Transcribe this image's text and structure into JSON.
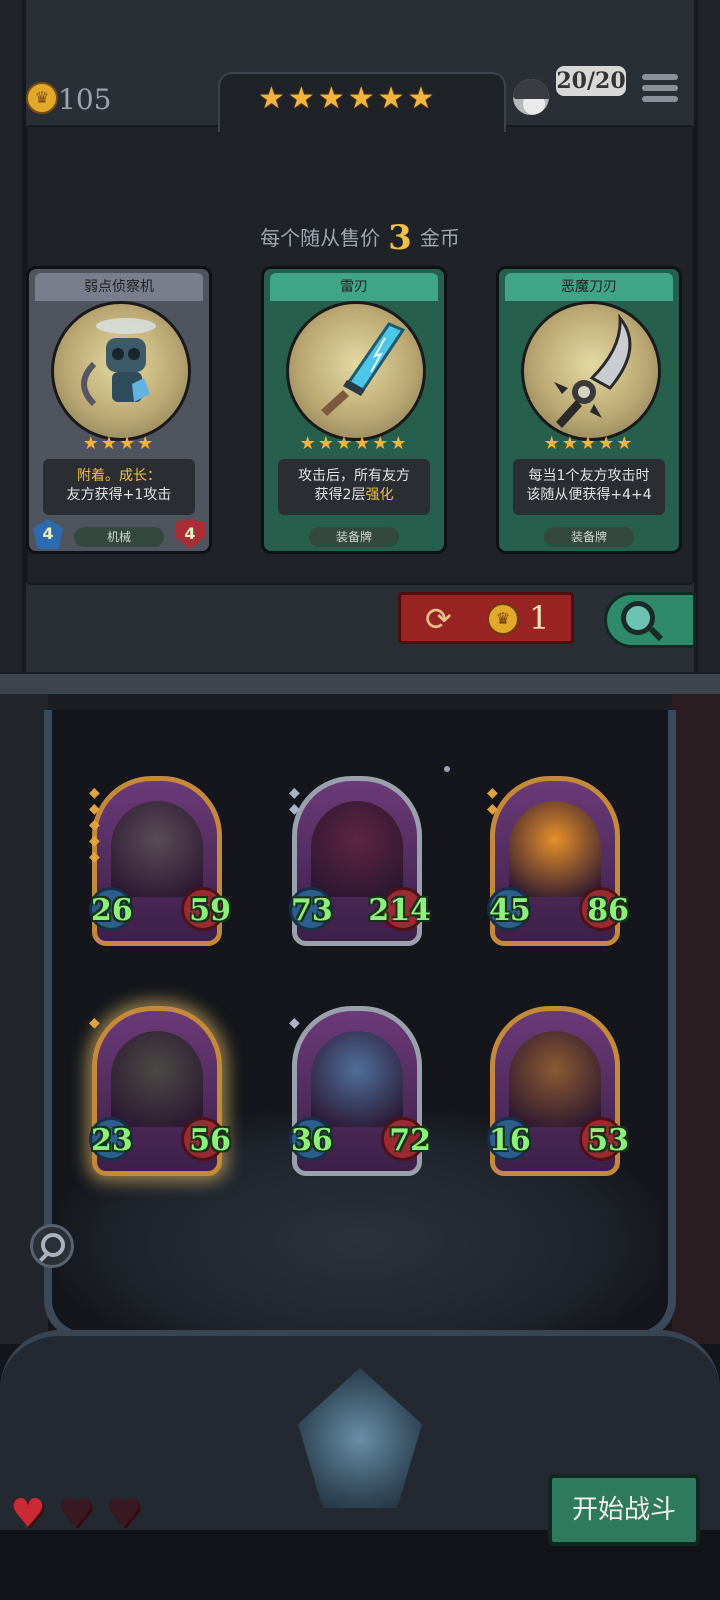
{
  "hud": {
    "gold": "105",
    "tavern_stars": 6,
    "health": "20/20",
    "sell_text": "每个随从售价",
    "sell_price": "3",
    "sell_unit": "金币"
  },
  "shop_cards": [
    {
      "title": "弱点侦察机",
      "stars": 4,
      "desc_highlight": "附着。成长：",
      "desc_text": "友方获得+1攻击",
      "type": "机械",
      "attack": "4",
      "health": "4",
      "theme": "#6f7381"
    },
    {
      "title": "雷刃",
      "stars": 6,
      "desc_pre": "攻击后，所有友方",
      "desc_mid": "获得2层",
      "desc_highlight": "强化",
      "type": "装备牌",
      "theme": "#2f8a6c"
    },
    {
      "title": "恶魔刀刃",
      "stars": 5,
      "desc_line1": "每当1个友方攻击时",
      "desc_line2": "该随从便获得+4+4",
      "type": "装备牌",
      "theme": "#2f8a6c"
    }
  ],
  "refresh": {
    "cost": "1",
    "icon": "refresh-icon"
  },
  "board": [
    {
      "name": "flame-bulldog",
      "attack": "26",
      "health": "59",
      "frame": "gold",
      "tier": 5,
      "art_color": "#5a4c56"
    },
    {
      "name": "dark-elf-sorceress",
      "attack": "73",
      "health": "214",
      "frame": "silver",
      "tier": 2,
      "art_color": "#5d2540"
    },
    {
      "name": "pumpkin-ghost",
      "attack": "45",
      "health": "86",
      "frame": "gold",
      "tier": 2,
      "art_color": "#e5902a"
    },
    {
      "name": "scarecrow-reaper",
      "attack": "23",
      "health": "56",
      "frame": "gold",
      "tier": 1,
      "art_color": "#4b4a45"
    },
    {
      "name": "succubus-elf",
      "attack": "36",
      "health": "72",
      "frame": "silver",
      "tier": 1,
      "art_color": "#4f6f9a"
    },
    {
      "name": "drill-robot",
      "attack": "16",
      "health": "53",
      "frame": "gold",
      "tier": 0,
      "art_color": "#8a5a32"
    }
  ],
  "lives": {
    "filled": 1,
    "total": 3
  },
  "start_button": "开始战斗",
  "colors": {
    "gold": "#f0c040",
    "accent_green": "#2f8a6c",
    "refresh_red": "#9a2323",
    "stat_green": "#8cf07a"
  }
}
